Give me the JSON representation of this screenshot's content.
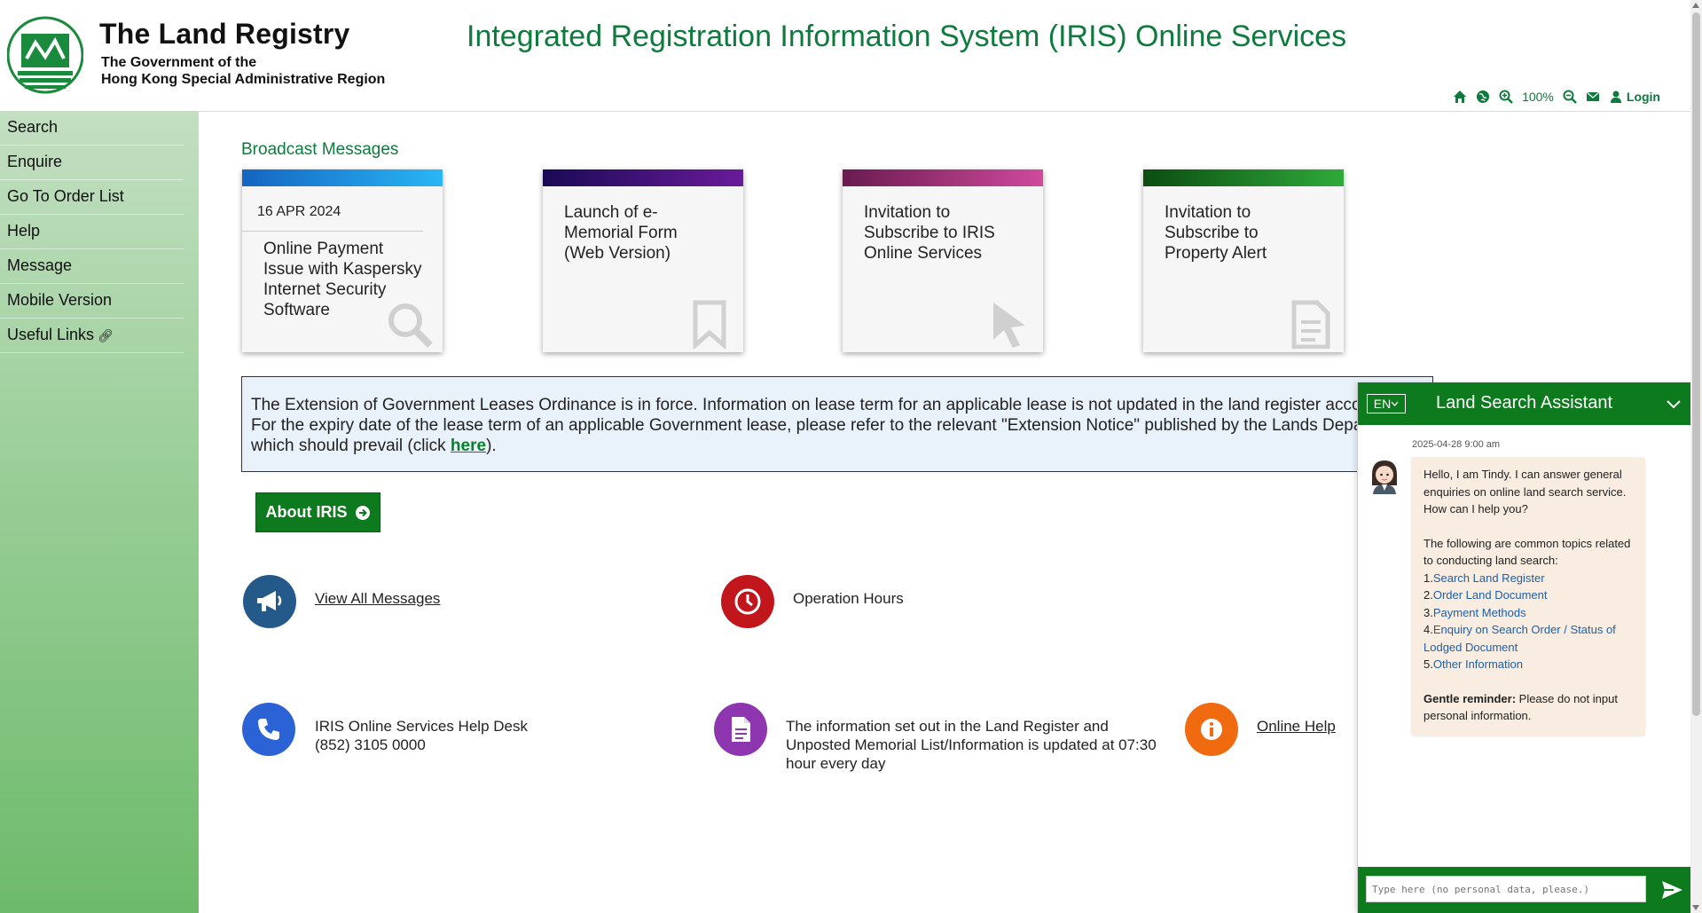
{
  "header": {
    "org_name": "The Land Registry",
    "org_sub_1": "The Government of the",
    "org_sub_2": "Hong Kong Special Administrative Region",
    "system_title": "Integrated Registration Information System (IRIS) Online Services",
    "zoom_level": "100%",
    "login_label": "Login"
  },
  "sidebar": {
    "items": [
      {
        "label": "Search"
      },
      {
        "label": "Enquire"
      },
      {
        "label": "Go To Order List"
      },
      {
        "label": "Help"
      },
      {
        "label": "Message"
      },
      {
        "label": "Mobile Version"
      },
      {
        "label": "Useful Links"
      }
    ]
  },
  "broadcast": {
    "title": "Broadcast Messages",
    "cards": [
      {
        "date": "16 APR 2024",
        "line1": "Online Payment",
        "line2": "Issue with Kaspersky",
        "line3": "Internet Security",
        "line4": "Software",
        "icon": "search-icon",
        "color_from": "#1565c0",
        "color_to": "#29b6f6"
      },
      {
        "line1": "Launch of e-",
        "line2": "Memorial Form",
        "line3": "(Web Version)",
        "icon": "bookmark-icon",
        "color_from": "#1a0a55",
        "color_to": "#6a1b9a"
      },
      {
        "line1": "Invitation to",
        "line2": "Subscribe to IRIS",
        "line3": "Online Services",
        "icon": "cursor-icon",
        "color_from": "#6a1b50",
        "color_to": "#d04a9c"
      },
      {
        "line1": "Invitation to",
        "line2": "Subscribe to",
        "line3": "Property Alert",
        "icon": "document-icon",
        "color_from": "#0b4d12",
        "color_to": "#2faa3a"
      }
    ]
  },
  "notice": {
    "line1": "The Extension of Government Leases Ordinance is in force.  Information on lease term for an applicable lease is not updated in the land register accordingly.",
    "line2": "For the expiry date of the lease term of an applicable Government lease, please refer to the relevant \"Extension Notice\" published by the Lands Department",
    "line3_before": "which should prevail (click ",
    "line3_link": "here",
    "line3_after": ")."
  },
  "about_button": {
    "label": "About IRIS"
  },
  "info": {
    "view_all": "View All Messages",
    "operation_hours": "Operation Hours",
    "helpdesk_line1": "IRIS Online Services Help Desk",
    "helpdesk_line2": "(852) 3105 0000",
    "update_line1": "The information set out in the Land Register and",
    "update_line2": "Unposted Memorial List/Information is updated at 07:30",
    "update_line3": "hour every day",
    "online_help": "Online Help",
    "colors": {
      "megaphone": "#245a8a",
      "clock": "#c0161c",
      "phone": "#2b63d6",
      "document": "#8e35b0",
      "info": "#f06a10"
    }
  },
  "chat": {
    "lang": "EN",
    "title": "Land Search Assistant",
    "timestamp": "2025-04-28 9:00 am",
    "greet1": "Hello, I am Tindy.  I can answer general",
    "greet2": "enquiries on online land search service.",
    "greet3": "How can I help you?",
    "intro1": "The following are common topics related",
    "intro2": "to conducting land search:",
    "topics": [
      {
        "num": "1.",
        "label": "Search Land Register"
      },
      {
        "num": "2.",
        "label": "Order Land Document"
      },
      {
        "num": "3.",
        "label": "Payment Methods"
      },
      {
        "num": "4.",
        "label": "Enquiry on Search Order / Status of"
      },
      {
        "num": "",
        "label": "Lodged Document"
      },
      {
        "num": "5.",
        "label": "Other Information"
      }
    ],
    "reminder_bold": "Gentle reminder:",
    "reminder_rest": " Please do not input",
    "reminder_line2": "personal information.",
    "input_placeholder": "Type here (no personal data, please.)"
  }
}
